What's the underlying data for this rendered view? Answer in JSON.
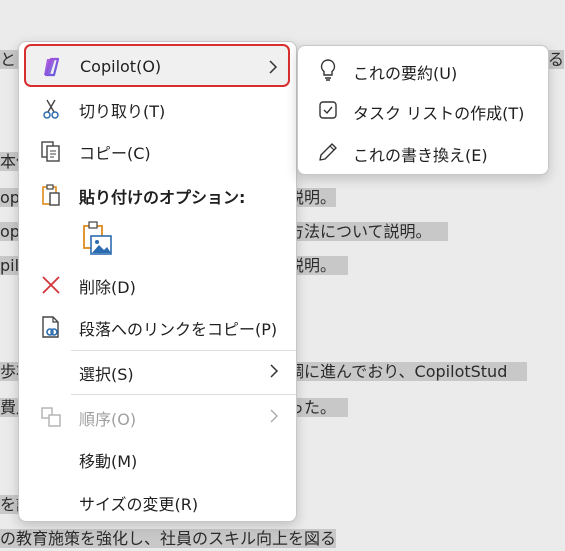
{
  "document": {
    "lines": [
      {
        "text": "と目",
        "extra": "る"
      },
      {
        "text": "本像"
      },
      {
        "text": "opi",
        "right": "説明。"
      },
      {
        "text": "op",
        "right": "方法について説明。"
      },
      {
        "text": "pil",
        "right": "説明。"
      },
      {
        "text": "歩状",
        "right": "調に進んでおり、CopilotStud"
      },
      {
        "text": "費月",
        "right": "った。"
      },
      {
        "text": "を記"
      },
      {
        "text": "の教育施策を強化し、社員のスキル向上を図る"
      }
    ]
  },
  "context_menu": {
    "items": [
      {
        "label": "Copilot(O)",
        "icon": "copilot-icon",
        "has_submenu": true
      },
      {
        "label": "切り取り(T)",
        "icon": "scissors-icon"
      },
      {
        "label": "コピー(C)",
        "icon": "copy-icon"
      },
      {
        "label": "貼り付けのオプション:",
        "icon": "paste-icon"
      },
      {
        "label": "削除(D)",
        "icon": "delete-x-icon"
      },
      {
        "label": "段落へのリンクをコピー(P)",
        "icon": "link-paragraph-icon"
      },
      {
        "label": "選択(S)",
        "has_submenu": true
      },
      {
        "label": "順序(O)",
        "icon": "order-icon",
        "has_submenu": true,
        "disabled": true
      },
      {
        "label": "移動(M)"
      },
      {
        "label": "サイズの変更(R)"
      }
    ],
    "paste_option_icon": "paste-picture-icon"
  },
  "copilot_submenu": {
    "items": [
      {
        "label": "これの要約(U)",
        "icon": "lightbulb-icon"
      },
      {
        "label": "タスク リストの作成(T)",
        "icon": "checkbox-icon"
      },
      {
        "label": "これの書き換え(E)",
        "icon": "pencil-icon"
      }
    ]
  },
  "colors": {
    "highlight_border": "#d92e2e",
    "delete_icon": "#d13438",
    "paste_accent": "#e08a1e",
    "icon_blue": "#2b6cb0"
  }
}
